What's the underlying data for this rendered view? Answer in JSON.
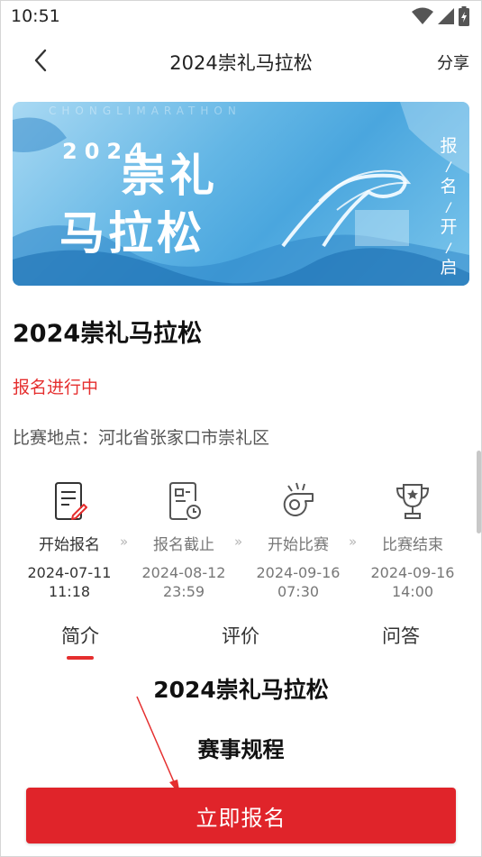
{
  "status_bar": {
    "time": "10:51",
    "icons": [
      "wifi-icon",
      "signal-icon",
      "battery-icon"
    ]
  },
  "nav": {
    "title": "2024崇礼马拉松",
    "share_label": "分享",
    "back_icon": "chevron-left-icon"
  },
  "banner": {
    "year": "2024",
    "title_line1": "崇礼",
    "title_line2": "马拉松",
    "vertical_text": "报/名/开/启"
  },
  "event": {
    "title": "2024崇礼马拉松",
    "status": "报名进行中",
    "location_label": "比赛地点：",
    "location_value": "河北省张家口市崇礼区"
  },
  "steps": [
    {
      "icon": "register-doc-icon",
      "label": "开始报名",
      "date": "2024-07-11",
      "time": "11:18"
    },
    {
      "icon": "deadline-doc-icon",
      "label": "报名截止",
      "date": "2024-08-12",
      "time": "23:59"
    },
    {
      "icon": "whistle-icon",
      "label": "开始比赛",
      "date": "2024-09-16",
      "time": "07:30"
    },
    {
      "icon": "trophy-icon",
      "label": "比赛结束",
      "date": "2024-09-16",
      "time": "14:00"
    }
  ],
  "step_arrow": "»",
  "tabs": [
    {
      "label": "简介",
      "active": true
    },
    {
      "label": "评价",
      "active": false
    },
    {
      "label": "问答",
      "active": false
    }
  ],
  "content": {
    "title": "2024崇礼马拉松",
    "subtitle": "赛事规程"
  },
  "register_button": "立即报名",
  "colors": {
    "accent_red": "#e0242a",
    "status_red": "#e52e2e",
    "banner_blue": "#4aa6de"
  }
}
